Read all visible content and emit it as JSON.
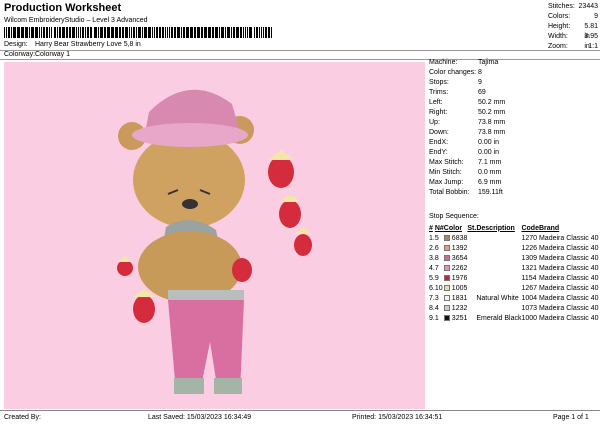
{
  "header": {
    "title": "Production Worksheet",
    "subtitle": "Wilcom EmbroideryStudio – Level 3 Advanced",
    "barcode_tick": ","
  },
  "summary": [
    {
      "label": "Stitches:",
      "value": "23443"
    },
    {
      "label": "Colors:",
      "value": "9"
    },
    {
      "label": "Height:",
      "value": "5.81 in"
    },
    {
      "label": "Width:",
      "value": "3.95 in"
    },
    {
      "label": "Zoom:",
      "value": "1:1"
    }
  ],
  "design_info": [
    {
      "label": "Design:",
      "value": "Harry Bear Strawberry Love 5,8 in"
    },
    {
      "label": "Colorway:",
      "value": "Colorway 1"
    }
  ],
  "machine_info": [
    {
      "label": "Machine:",
      "value": "Tajima"
    },
    {
      "label": "Color changes:",
      "value": "8"
    },
    {
      "label": "Stops:",
      "value": "9"
    },
    {
      "label": "Trims:",
      "value": "69"
    },
    {
      "label": "Left:",
      "value": "50.2 mm"
    },
    {
      "label": "Right:",
      "value": "50.2 mm"
    },
    {
      "label": "Up:",
      "value": "73.8 mm"
    },
    {
      "label": "Down:",
      "value": "73.8 mm"
    },
    {
      "label": "EndX:",
      "value": "0.00 in"
    },
    {
      "label": "EndY:",
      "value": "0.00 in"
    },
    {
      "label": "Max Stitch:",
      "value": "7.1 mm"
    },
    {
      "label": "Min Stitch:",
      "value": "0.0 mm"
    },
    {
      "label": "Max Jump:",
      "value": "6.9 mm"
    },
    {
      "label": "Total Bobbin:",
      "value": "159.11ft"
    }
  ],
  "stop_sequence": {
    "title": "Stop Sequence:",
    "headers": [
      "#",
      "N#",
      "Color",
      "St.",
      "Description",
      "Code",
      "Brand"
    ],
    "rows": [
      {
        "n": "1.",
        "nn": "5",
        "color": "6838",
        "swatch": "#b0895b",
        "st": "",
        "desc": "",
        "code": "1270",
        "brand": "Madeira Classic 40"
      },
      {
        "n": "2.",
        "nn": "6",
        "color": "1392",
        "swatch": "#e89a78",
        "st": "",
        "desc": "",
        "code": "1226",
        "brand": "Madeira Classic 40"
      },
      {
        "n": "3.",
        "nn": "8",
        "color": "3654",
        "swatch": "#d8649a",
        "st": "",
        "desc": "",
        "code": "1309",
        "brand": "Madeira Classic 40"
      },
      {
        "n": "4.",
        "nn": "7",
        "color": "2262",
        "swatch": "#ec8fb8",
        "st": "",
        "desc": "",
        "code": "1321",
        "brand": "Madeira Classic 40"
      },
      {
        "n": "5.",
        "nn": "9",
        "color": "1976",
        "swatch": "#c8223b",
        "st": "",
        "desc": "",
        "code": "1154",
        "brand": "Madeira Classic 40"
      },
      {
        "n": "6.",
        "nn": "10",
        "color": "1005",
        "swatch": "#f1d9a0",
        "st": "",
        "desc": "",
        "code": "1267",
        "brand": "Madeira Classic 40"
      },
      {
        "n": "7.",
        "nn": "3",
        "color": "1831",
        "swatch": "#f4f2ea",
        "st": "",
        "desc": "Natural White",
        "code": "1004",
        "brand": "Madeira Classic 40"
      },
      {
        "n": "8.",
        "nn": "4",
        "color": "1232",
        "swatch": "#c9ccc8",
        "st": "",
        "desc": "",
        "code": "1073",
        "brand": "Madeira Classic 40"
      },
      {
        "n": "9.",
        "nn": "1",
        "color": "3251",
        "swatch": "#111111",
        "st": "",
        "desc": "Emerald Black",
        "code": "1000",
        "brand": "Madeira Classic 40"
      }
    ]
  },
  "footer": {
    "created_by": "Created By:",
    "last_saved": "Last Saved: 15/03/2023 16:34:49",
    "printed": "Printed: 15/03/2023 16:34:51",
    "page": "Page 1 of 1"
  },
  "colors": {
    "design_background": "#fbcde2"
  }
}
